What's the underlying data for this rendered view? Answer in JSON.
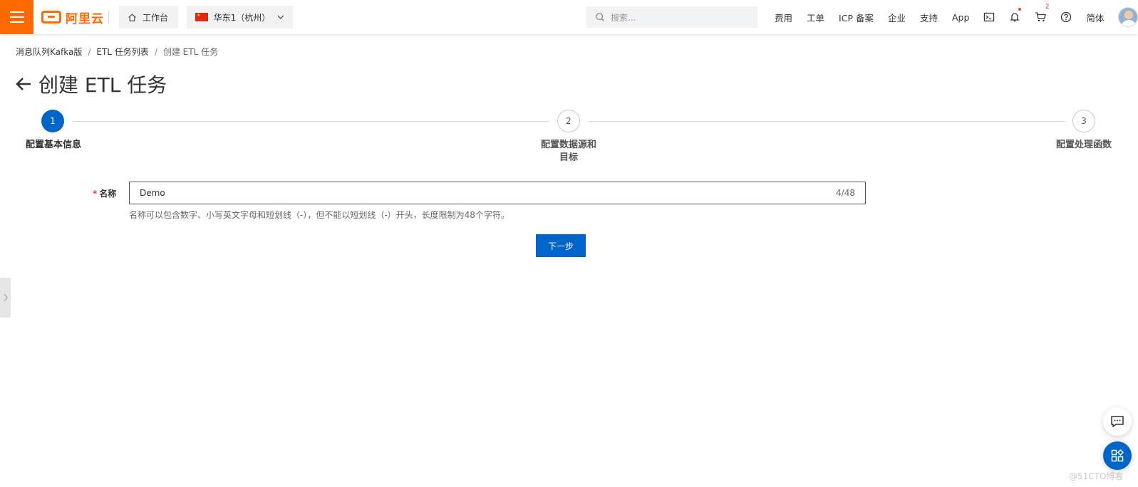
{
  "brand": {
    "name": "阿里云",
    "accent": "#ff6a00"
  },
  "topbar": {
    "workbench": "工作台",
    "region": "华东1（杭州）",
    "search_placeholder": "搜索...",
    "nav": [
      "费用",
      "工单",
      "ICP 备案",
      "企业",
      "支持",
      "App"
    ],
    "cart_count": "2",
    "language": "简体"
  },
  "breadcrumb": [
    "消息队列Kafka版",
    "ETL 任务列表",
    "创建 ETL 任务"
  ],
  "page_title": "创建 ETL 任务",
  "steps": [
    {
      "number": "1",
      "label": "配置基本信息",
      "status": "active"
    },
    {
      "number": "2",
      "label_line1": "配置数据源和",
      "label_line2": "目标",
      "status": "todo"
    },
    {
      "number": "3",
      "label": "配置处理函数",
      "status": "todo"
    }
  ],
  "form": {
    "required_mark": "*",
    "name_label": "名称",
    "name_value": "Demo",
    "name_count": "4/48",
    "help_text": "名称可以包含数字、小写英文字母和短划线（-），但不能以短划线（-）开头，长度限制为48个字符。",
    "next_button": "下一步"
  },
  "colors": {
    "primary": "#0064c8",
    "danger": "#f23c3c"
  },
  "watermark": "@51CTO博客"
}
